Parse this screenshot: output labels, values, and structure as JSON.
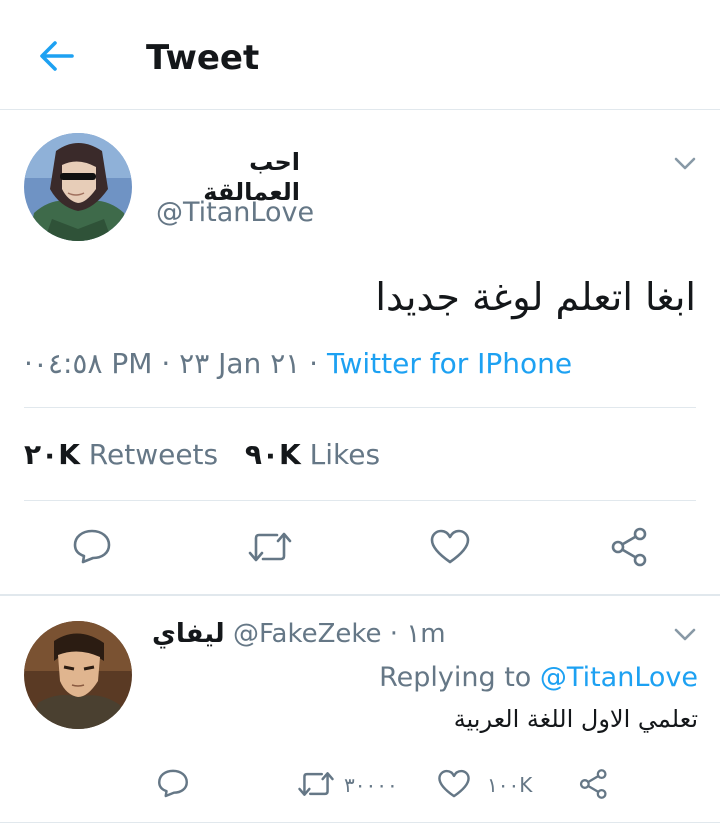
{
  "header": {
    "title": "Tweet"
  },
  "tweet": {
    "author_name": "احب العمالقة",
    "author_handle": "@TitanLove",
    "text": "ابغا اتعلم لوغة جديدا",
    "time": "·٠٤:٥٨ PM · ٢٣ Jan ٢١ · ",
    "source": "Twitter for IPhone",
    "retweets_count": "٢٠K",
    "retweets_label": " Retweets",
    "likes_count": "٩٠K",
    "likes_label": " Likes"
  },
  "reply": {
    "name": "ليفاي",
    "handle_time": " @FakeZeke · ١m",
    "replying_prefix": "Replying to ",
    "replying_handle": "@TitanLove",
    "text": "تعلمي الاول اللغة العربية",
    "retweet_count": "٣٠٠٠٠",
    "like_count": "١٠٠K"
  },
  "icons": {
    "back": "arrow-left-icon",
    "menu": "chevron-down-icon",
    "reply": "comment-icon",
    "retweet": "retweet-icon",
    "like": "heart-icon",
    "share": "share-icon"
  },
  "colors": {
    "accent": "#1da1f2",
    "secondary_text": "#657786",
    "divider": "#e1e8ed"
  }
}
